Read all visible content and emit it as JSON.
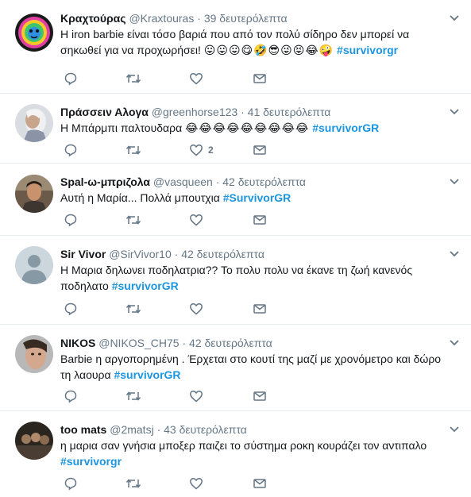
{
  "tweets": [
    {
      "name": "Κραχτούρας",
      "handle": "@Kraxtouras",
      "time": "39 δευτερόλεπτα",
      "text": "Η iron barbie είναι τόσο βαριά που από τον πολύ σίδηρο δεν μπορεί να σηκωθεί για να προχωρήσει!",
      "emoji": "😛😛😛😋🤣😎😜😝😂🤪",
      "hashtag": "#survivorgr",
      "like_count": "",
      "avatar_icon": "colorful-lion-icon"
    },
    {
      "name": "Πράσσειν Αλογα",
      "handle": "@greenhorse123",
      "time": "41 δευτερόλεπτα",
      "text": "Η Μπάρμπι παλτουδαρα",
      "emoji": "😂😂😂😂😂😂😂😂😂",
      "hashtag": "#survivorGR",
      "like_count": "2",
      "avatar_icon": "person-photo-icon"
    },
    {
      "name": "Spal-ω-μπριζολα",
      "handle": "@vasqueen",
      "time": "42 δευτερόλεπτα",
      "text": "Αυτή η Μαρία... Πολλά μπουτχια",
      "emoji": "",
      "hashtag": "#SurvivorGR",
      "like_count": "",
      "avatar_icon": "person-photo-icon"
    },
    {
      "name": "Sir Vivor",
      "handle": "@SirVivor10",
      "time": "42 δευτερόλεπτα",
      "text": "Η Μαρια δηλωνει ποδηλατρια?? Το πολυ πολυ να έκανε τη ζωή κανενός ποδηλατο",
      "emoji": "",
      "hashtag": "#survivorGR",
      "like_count": "",
      "avatar_icon": "default-profile-icon"
    },
    {
      "name": "NIKOS",
      "handle": "@NIKOS_CH75",
      "time": "42 δευτερόλεπτα",
      "text": "Barbie η αργοπορημένη . Έρχεται στο κουτί της μαζί με χρονόμετρο και δώρο τη λαουρα",
      "emoji": "",
      "hashtag": "#survivorGR",
      "like_count": "",
      "avatar_icon": "person-photo-icon"
    },
    {
      "name": "too mats",
      "handle": "@2matsj",
      "time": "43 δευτερόλεπτα",
      "text": "η μαρια σαν γνήσια μποξερ παιζει το σύστημα ροκη κουράζει τον αντιπαλο",
      "emoji": "",
      "hashtag": "#survivorgr",
      "like_count": "",
      "avatar_icon": "group-photo-icon"
    }
  ],
  "separator": "·",
  "colors": {
    "hashtag": "#1b95e0",
    "secondary_text": "#657786",
    "icon": "#657786",
    "divider": "#e6ecf0"
  },
  "action_icons": [
    "reply-icon",
    "retweet-icon",
    "like-icon",
    "direct-message-icon"
  ]
}
